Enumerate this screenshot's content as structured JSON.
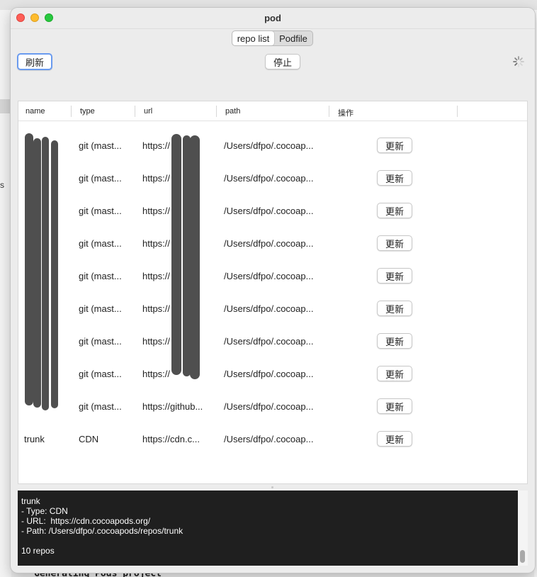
{
  "window": {
    "title": "pod"
  },
  "tabs": [
    {
      "label": "repo list",
      "selected": true
    },
    {
      "label": "Podfile",
      "selected": false
    }
  ],
  "toolbar": {
    "refresh_label": "刷新",
    "stop_label": "停止"
  },
  "background": {
    "side_text": "s",
    "bottom_text": "Generating Pods project"
  },
  "table": {
    "columns": [
      "name",
      "type",
      "url",
      "path",
      "操作"
    ],
    "action_label": "更新",
    "rows": [
      {
        "name": "",
        "type": "git (mast...",
        "url": "https://",
        "path": "/Users/dfpo/.cocoap..."
      },
      {
        "name": "",
        "type": "git (mast...",
        "url": "https://",
        "path": "/Users/dfpo/.cocoap..."
      },
      {
        "name": "",
        "type": "git (mast...",
        "url": "https://",
        "path": "/Users/dfpo/.cocoap..."
      },
      {
        "name": "",
        "type": "git (mast...",
        "url": "https://",
        "path": "/Users/dfpo/.cocoap..."
      },
      {
        "name": "",
        "type": "git (mast...",
        "url": "https://",
        "path": "/Users/dfpo/.cocoap..."
      },
      {
        "name": "",
        "type": "git (mast...",
        "url": "https://",
        "path": "/Users/dfpo/.cocoap..."
      },
      {
        "name": "",
        "type": "git (mast...",
        "url": "https://",
        "path": "/Users/dfpo/.cocoap..."
      },
      {
        "name": "",
        "type": "git (mast...",
        "url": "https://",
        "path": "/Users/dfpo/.cocoap..."
      },
      {
        "name": "",
        "type": "git (mast...",
        "url": "https://github...",
        "path": "/Users/dfpo/.cocoap..."
      },
      {
        "name": "trunk",
        "type": "CDN",
        "url": "https://cdn.c...",
        "path": "/Users/dfpo/.cocoap..."
      }
    ]
  },
  "console": {
    "lines": [
      "trunk",
      "- Type: CDN",
      "- URL:  https://cdn.cocoapods.org/",
      "- Path: /Users/dfpo/.cocoapods/repos/trunk",
      "",
      "10 repos"
    ]
  }
}
